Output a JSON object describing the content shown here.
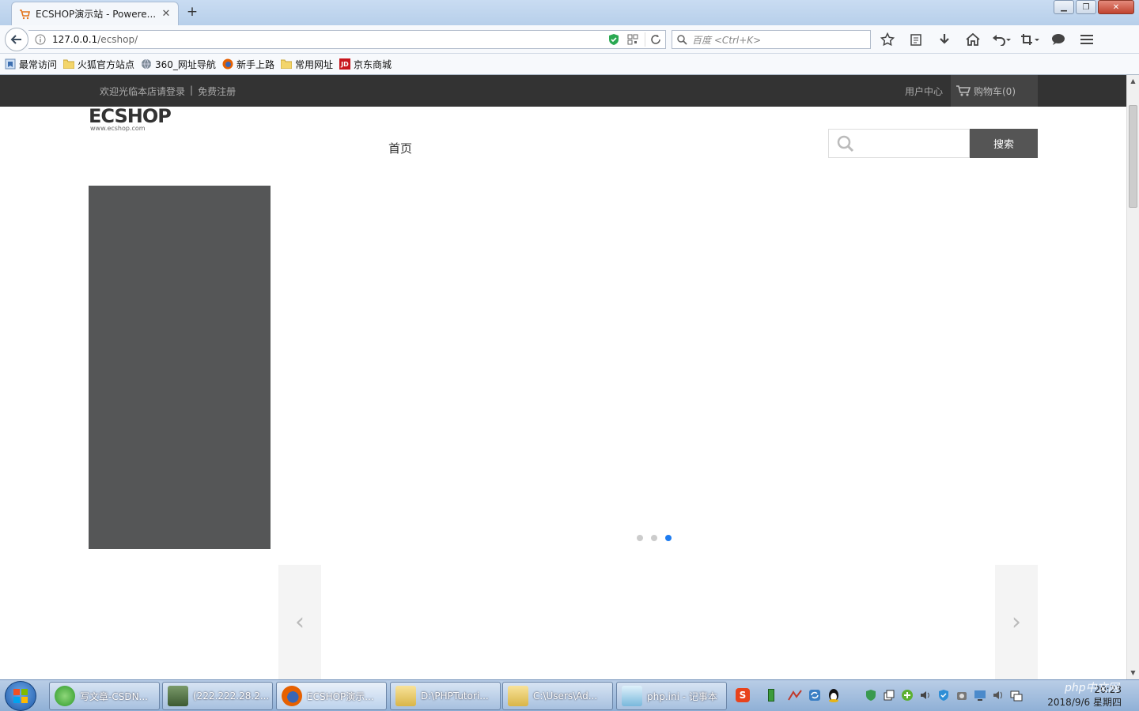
{
  "browser": {
    "tab_title": "ECSHOP演示站 - Powere...",
    "url_host": "127.0.0.1",
    "url_path": "/ecshop/",
    "search_placeholder": "百度 <Ctrl+K>",
    "bookmarks": [
      {
        "label": "最常访问",
        "icon": "bookmark-folder-icon"
      },
      {
        "label": "火狐官方站点",
        "icon": "folder-icon"
      },
      {
        "label": "360_网址导航",
        "icon": "globe-icon"
      },
      {
        "label": "新手上路",
        "icon": "firefox-icon"
      },
      {
        "label": "常用网址",
        "icon": "folder-icon"
      },
      {
        "label": "京东商城",
        "icon": "jd-icon"
      }
    ]
  },
  "site": {
    "welcome": "欢迎光临本店请登录",
    "separator": "|",
    "register": "免费注册",
    "user_center": "用户中心",
    "cart": "购物车(0)",
    "logo_text": "ECSHOP",
    "logo_sub": "www.ecshop.com",
    "nav_home": "首页",
    "search_button": "搜索",
    "carousel_dots": 3,
    "carousel_active": 3,
    "colors": {
      "topbar": "#333333",
      "category_panel": "#555657",
      "active_dot": "#1e7cf0"
    }
  },
  "taskbar": {
    "tasks": [
      {
        "label": "写文章-CSDN...",
        "icon": "refresh-browser-icon"
      },
      {
        "label": "(222.222.28.2...",
        "icon": "remote-desktop-icon"
      },
      {
        "label": "ECSHOP演示...",
        "icon": "firefox-icon"
      },
      {
        "label": "D:\\PHPTutori...",
        "icon": "folder-icon"
      },
      {
        "label": "C:\\Users\\Ad...",
        "icon": "folder-icon"
      },
      {
        "label": "php.ini - 记事本",
        "icon": "notepad-icon"
      }
    ],
    "clock_time": "20:23",
    "clock_date": "2018/9/6 星期四",
    "watermark": "php中文网"
  }
}
